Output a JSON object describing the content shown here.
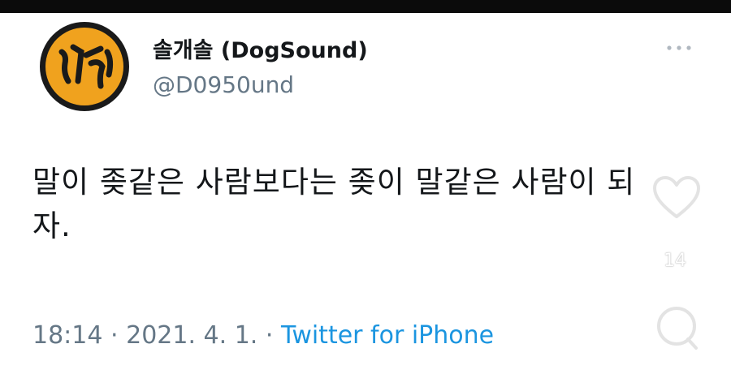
{
  "tweet": {
    "display_name": "솔개솔 (DogSound)",
    "handle": "@D0950und",
    "text": "말이 좆같은 사람보다는 좆이 말같은 사람이 되자.",
    "time": "18:14",
    "date": "2021. 4. 1.",
    "separator": "·",
    "source": "Twitter for iPhone"
  },
  "overlay": {
    "like_count": "14"
  },
  "icons": {
    "avatar": "avatar-logo",
    "more": "more-dots-icon",
    "heart": "heart-icon",
    "comment": "comment-bubble-icon"
  },
  "colors": {
    "text": "#14171a",
    "secondary": "#657786",
    "link": "#1b95e0",
    "avatar_fill": "#f0a21e"
  }
}
